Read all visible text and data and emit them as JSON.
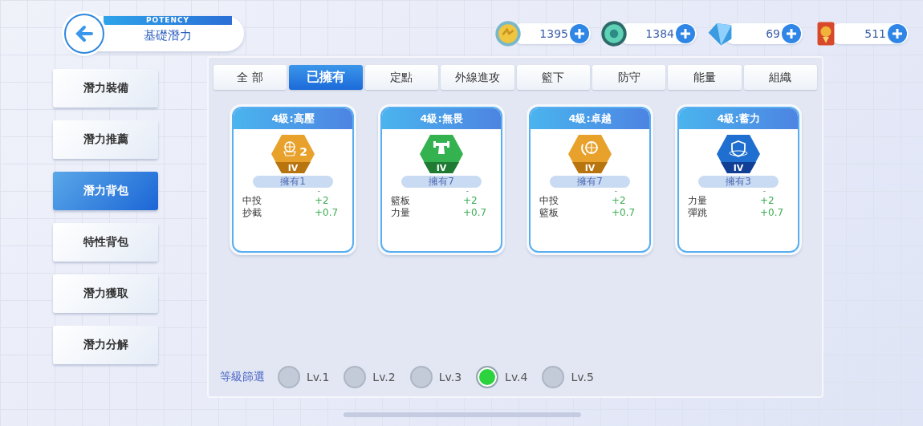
{
  "header": {
    "subtitle": "POTENCY",
    "title": "基礎潛力"
  },
  "currencies": [
    {
      "amount": "1395"
    },
    {
      "amount": "1384"
    },
    {
      "amount": "69"
    },
    {
      "amount": "511"
    }
  ],
  "sidebar": {
    "items": [
      {
        "label": "潛力裝備",
        "selected": false
      },
      {
        "label": "潛力推薦",
        "selected": false
      },
      {
        "label": "潛力背包",
        "selected": true
      },
      {
        "label": "特性背包",
        "selected": false
      },
      {
        "label": "潛力獲取",
        "selected": false
      },
      {
        "label": "潛力分解",
        "selected": false
      }
    ]
  },
  "tabs": [
    {
      "label": "全 部",
      "selected": false
    },
    {
      "label": "已擁有",
      "selected": true
    },
    {
      "label": "定點",
      "selected": false
    },
    {
      "label": "外線進攻",
      "selected": false
    },
    {
      "label": "籃下",
      "selected": false
    },
    {
      "label": "防守",
      "selected": false
    },
    {
      "label": "能量",
      "selected": false
    },
    {
      "label": "組織",
      "selected": false
    }
  ],
  "cards": [
    {
      "title": "4級:高壓",
      "color": "#e8a12a",
      "badge_number": "2",
      "tier": "IV",
      "owned": "擁有1",
      "dash": "-",
      "stats": [
        {
          "name": "中投",
          "value": "+2"
        },
        {
          "name": "抄截",
          "value": "+0.7"
        }
      ]
    },
    {
      "title": "4級:無畏",
      "color": "#34b24f",
      "tier": "IV",
      "owned": "擁有7",
      "dash": "-",
      "stats": [
        {
          "name": "籃板",
          "value": "+2"
        },
        {
          "name": "力量",
          "value": "+0.7"
        }
      ]
    },
    {
      "title": "4級:卓越",
      "color": "#e8a12a",
      "tier": "IV",
      "owned": "擁有7",
      "dash": "-",
      "stats": [
        {
          "name": "中投",
          "value": "+2"
        },
        {
          "name": "籃板",
          "value": "+0.7"
        }
      ]
    },
    {
      "title": "4級:蓄力",
      "color": "#1f6fd0",
      "tier": "IV",
      "owned": "擁有3",
      "dash": "-",
      "stats": [
        {
          "name": "力量",
          "value": "+2"
        },
        {
          "name": "彈跳",
          "value": "+0.7"
        }
      ]
    }
  ],
  "level_filter": {
    "label": "等級篩選",
    "levels": [
      {
        "label": "Lv.1",
        "selected": false
      },
      {
        "label": "Lv.2",
        "selected": false
      },
      {
        "label": "Lv.3",
        "selected": false
      },
      {
        "label": "Lv.4",
        "selected": true
      },
      {
        "label": "Lv.5",
        "selected": false
      }
    ]
  }
}
